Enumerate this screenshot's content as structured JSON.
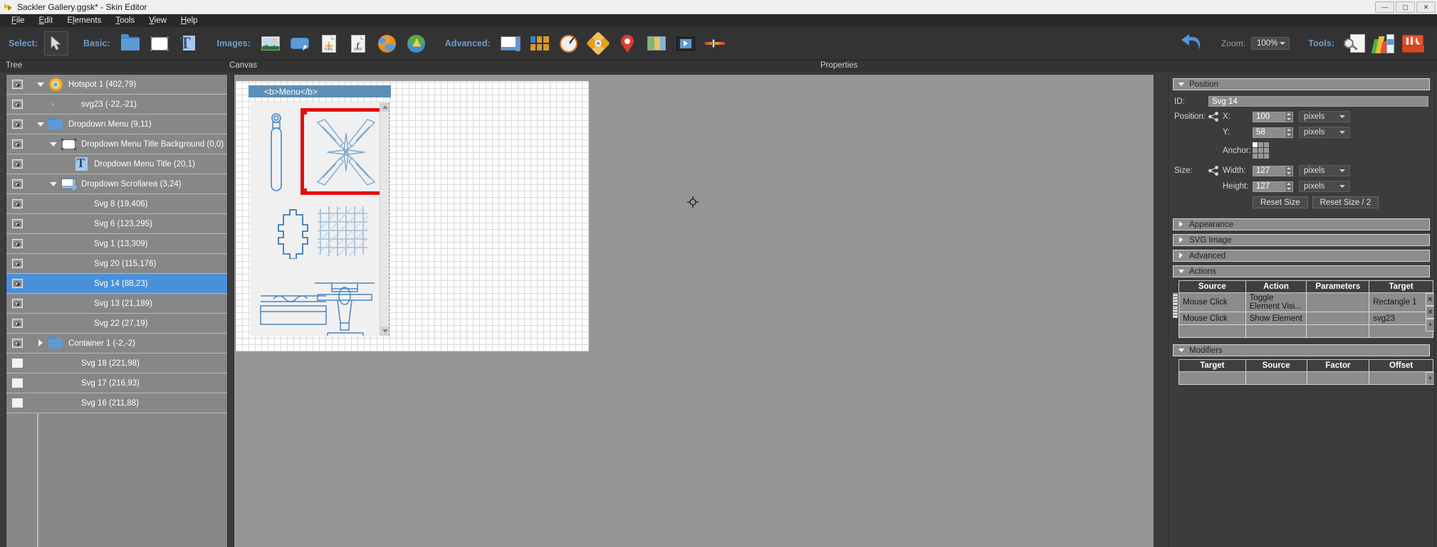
{
  "window": {
    "title": "Sackler Gallery.ggsk* - Skin Editor",
    "minimize": "—",
    "maximize": "▢",
    "close": "✕"
  },
  "menubar": [
    {
      "label": "File",
      "mnemonic": "F"
    },
    {
      "label": "Edit",
      "mnemonic": "E"
    },
    {
      "label": "Elements",
      "mnemonic": "l"
    },
    {
      "label": "Tools",
      "mnemonic": "T"
    },
    {
      "label": "View",
      "mnemonic": "V"
    },
    {
      "label": "Help",
      "mnemonic": "H"
    }
  ],
  "toolbar": {
    "select_label": "Select:",
    "basic_label": "Basic:",
    "images_label": "Images:",
    "advanced_label": "Advanced:",
    "tools_label": "Tools:",
    "zoom_label": "Zoom:",
    "zoom_value": "100%",
    "select_items": [
      {
        "name": "cursor-icon",
        "title": "Select"
      }
    ],
    "basic_items": [
      {
        "name": "folder-icon",
        "title": "Container"
      },
      {
        "name": "rectangle-icon",
        "title": "Rectangle"
      },
      {
        "name": "text-icon",
        "title": "Text"
      }
    ],
    "images_items": [
      {
        "name": "image-icon",
        "title": "Image"
      },
      {
        "name": "button-icon",
        "title": "Button"
      },
      {
        "name": "svg-file-icon",
        "title": "SVG",
        "doc_label": "SVG"
      },
      {
        "name": "swf-file-icon",
        "title": "SWF",
        "doc_label": "SWF"
      },
      {
        "name": "globe-icon",
        "title": "Map"
      },
      {
        "name": "globe-green-icon",
        "title": "World Map"
      }
    ],
    "advanced_items": [
      {
        "name": "window-icon",
        "title": "Window"
      },
      {
        "name": "grid-icon",
        "title": "Thumbnails"
      },
      {
        "name": "compass-icon",
        "title": "Compass"
      },
      {
        "name": "hotspot-icon",
        "title": "Hotspot"
      },
      {
        "name": "map-pin-icon",
        "title": "Map Pin"
      },
      {
        "name": "map-icon",
        "title": "Map"
      },
      {
        "name": "video-icon",
        "title": "Video"
      },
      {
        "name": "slider-icon",
        "title": "Slider"
      }
    ],
    "right_items": [
      {
        "name": "undo-icon",
        "title": "Undo"
      },
      {
        "name": "magnifier-document-icon",
        "title": "Inspector"
      },
      {
        "name": "color-palette-icon",
        "title": "Palette"
      },
      {
        "name": "toolbox-icon",
        "title": "Toolbox"
      }
    ]
  },
  "panels": {
    "tree_title": "Tree",
    "canvas_title": "Canvas",
    "properties_title": "Properties"
  },
  "tree": {
    "rows": [
      {
        "label": "Hotspot 1 (402,79)",
        "indent": 0,
        "twisty": "down",
        "icon": "hotspot-icon",
        "eye": "visible",
        "selected": false
      },
      {
        "label": "svg23 (-22,-21)",
        "indent": 1,
        "twisty": "dot",
        "icon": "none",
        "eye": "visible",
        "selected": false
      },
      {
        "label": "Dropdown Menu (9,11)",
        "indent": 0,
        "twisty": "down",
        "icon": "folder-icon",
        "eye": "visible",
        "selected": false
      },
      {
        "label": "Dropdown Menu Title Background (0,0)",
        "indent": 1,
        "twisty": "down",
        "icon": "rectangle-icon",
        "eye": "visible",
        "selected": false
      },
      {
        "label": "Dropdown Menu Title (20,1)",
        "indent": 2,
        "twisty": "none",
        "icon": "text-icon",
        "eye": "visible",
        "selected": false
      },
      {
        "label": "Dropdown Scrollarea (3,24)",
        "indent": 1,
        "twisty": "down",
        "icon": "scrollarea-icon",
        "eye": "visible",
        "selected": false
      },
      {
        "label": "Svg 8 (19,406)",
        "indent": 2,
        "twisty": "none",
        "icon": "none",
        "eye": "visible",
        "selected": false
      },
      {
        "label": "Svg 6 (123,295)",
        "indent": 2,
        "twisty": "none",
        "icon": "none",
        "eye": "visible",
        "selected": false
      },
      {
        "label": "Svg 1 (13,309)",
        "indent": 2,
        "twisty": "none",
        "icon": "none",
        "eye": "visible",
        "selected": false
      },
      {
        "label": "Svg 20 (115,176)",
        "indent": 2,
        "twisty": "none",
        "icon": "none",
        "eye": "visible",
        "selected": false
      },
      {
        "label": "Svg 14 (88,23)",
        "indent": 2,
        "twisty": "none",
        "icon": "none",
        "eye": "visible",
        "selected": true
      },
      {
        "label": "Svg 13 (21,189)",
        "indent": 2,
        "twisty": "none",
        "icon": "none",
        "eye": "visible",
        "selected": false
      },
      {
        "label": "Svg 22 (27,19)",
        "indent": 2,
        "twisty": "none",
        "icon": "none",
        "eye": "visible",
        "selected": false
      },
      {
        "label": "Container 1 (-2,-2)",
        "indent": 0,
        "twisty": "right",
        "icon": "folder-icon",
        "eye": "visible",
        "selected": false
      },
      {
        "label": "Svg 18 (221,98)",
        "indent": 1,
        "twisty": "none",
        "icon": "none",
        "eye": "hidden",
        "selected": false
      },
      {
        "label": "Svg 17 (216,93)",
        "indent": 1,
        "twisty": "none",
        "icon": "none",
        "eye": "hidden",
        "selected": false
      },
      {
        "label": "Svg 16 (211,88)",
        "indent": 1,
        "twisty": "none",
        "icon": "none",
        "eye": "hidden",
        "selected": false
      }
    ]
  },
  "canvas": {
    "menu_title": "<b>Menu</b>",
    "scroll_up": "▲",
    "scroll_down": "▼",
    "selected_thumb": "svg-tools-star",
    "thumbnails": [
      "svg-mirror-probe",
      "svg-tools-star",
      "svg-cross-plate",
      "svg-lattice-grid",
      "svg-layer-section",
      "svg-fixture-elevation",
      "svg-profile-curve"
    ]
  },
  "properties": {
    "sections": [
      {
        "label": "Position",
        "expanded": true
      },
      {
        "label": "Appearance",
        "expanded": false
      },
      {
        "label": "SVG Image",
        "expanded": false
      },
      {
        "label": "Advanced",
        "expanded": false
      },
      {
        "label": "Actions",
        "expanded": true
      },
      {
        "label": "Modifiers",
        "expanded": true
      }
    ],
    "position": {
      "id_label": "ID:",
      "id_value": "Svg 14",
      "position_label": "Position:",
      "x_label": "X:",
      "x_value": "100",
      "x_unit": "pixels",
      "y_label": "Y:",
      "y_value": "58",
      "y_unit": "pixels",
      "anchor_label": "Anchor:",
      "anchor_selected": "top-left",
      "size_label": "Size:",
      "width_label": "Width:",
      "width_value": "127",
      "width_unit": "pixels",
      "height_label": "Height:",
      "height_value": "127",
      "height_unit": "pixels",
      "reset_size": "Reset Size",
      "reset_size_half": "Reset Size / 2"
    },
    "actions": {
      "columns": [
        "Source",
        "Action",
        "Parameters",
        "Target"
      ],
      "rows": [
        {
          "source": "Mouse Click",
          "action": "Toggle Element Visi...",
          "parameters": "",
          "target": "Rectangle 1",
          "button": "✕"
        },
        {
          "source": "Mouse Click",
          "action": "Show Element",
          "parameters": "",
          "target": "svg23",
          "button": "✕"
        },
        {
          "source": "",
          "action": "",
          "parameters": "",
          "target": "",
          "button": "+"
        }
      ]
    },
    "modifiers": {
      "columns": [
        "Target",
        "Source",
        "Factor",
        "Offset"
      ],
      "rows": [
        {
          "target": "",
          "source": "",
          "factor": "",
          "offset": "",
          "button": "+"
        }
      ]
    }
  },
  "colors": {
    "accent_blue": "#4a90d9",
    "toolbar_label": "#6c9ccf",
    "selection_red": "#e01010",
    "panel_gray": "#878787",
    "chrome_dark": "#333333"
  }
}
